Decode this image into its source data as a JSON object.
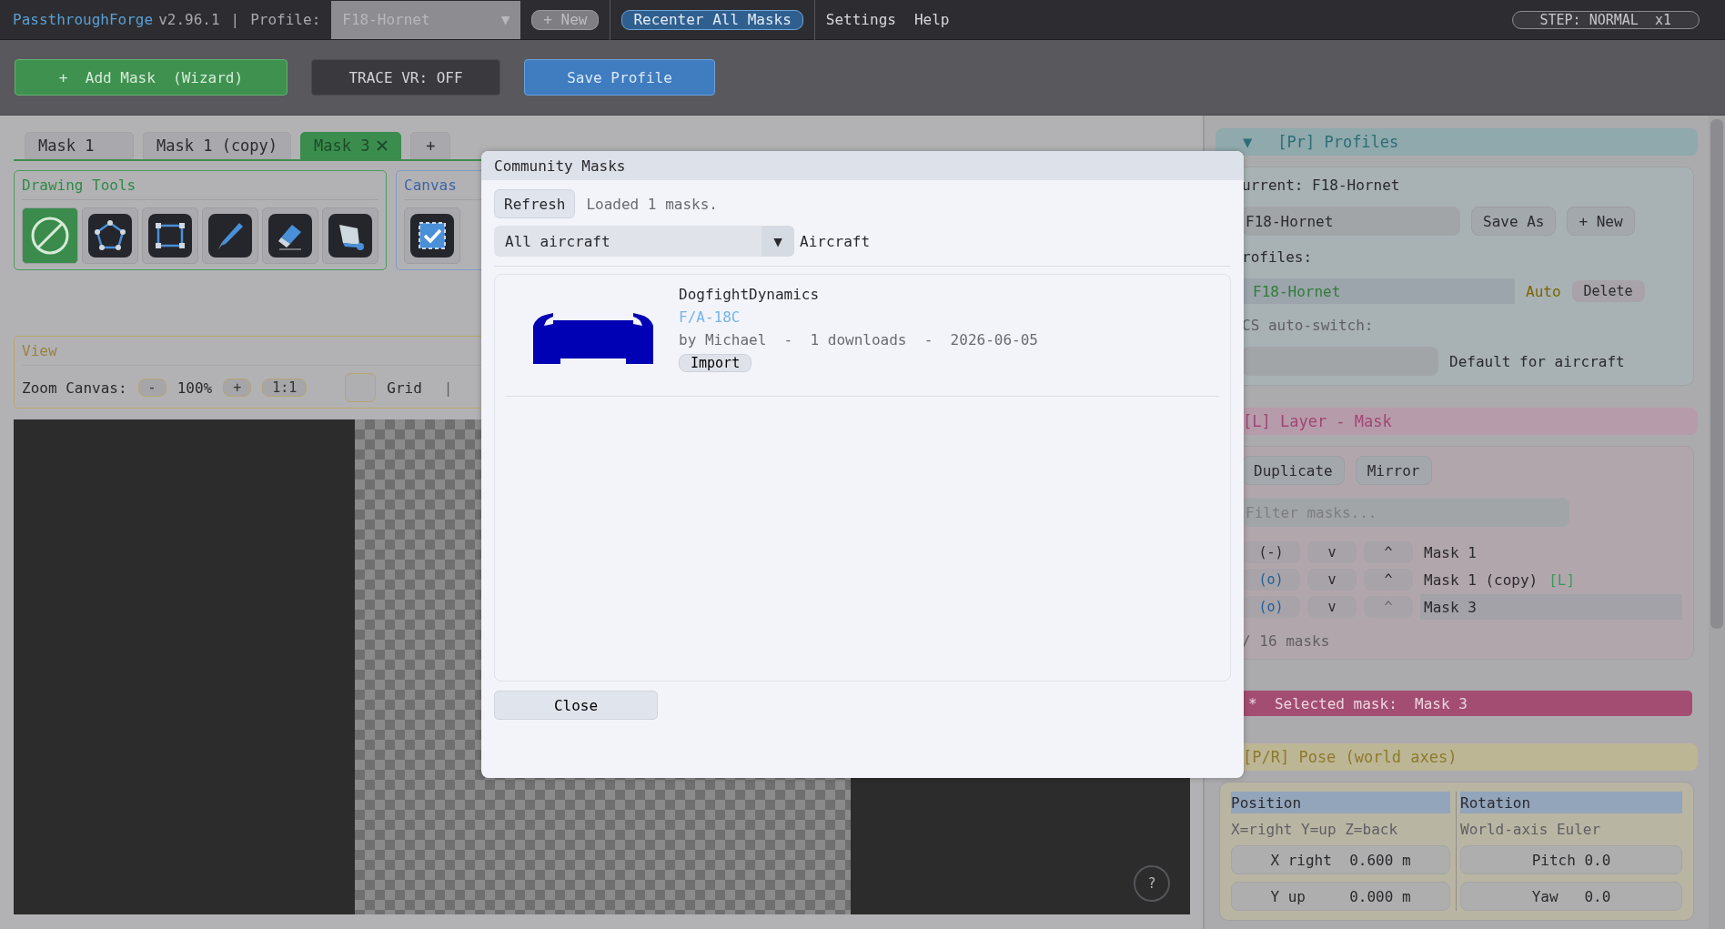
{
  "topbar": {
    "title": "PassthroughForge",
    "version": "v2.96.1",
    "separator": "|",
    "profile_label": "Profile:",
    "profile_value": "F18-Hornet",
    "profile_arrow": "▼",
    "new_button": "+ New",
    "recenter_button": "Recenter All Masks",
    "menu": [
      "Settings",
      "Help"
    ],
    "step_badge": "STEP: NORMAL  x1"
  },
  "toolbar": [
    {
      "label": "+  Add Mask  (Wizard)",
      "kind": "green"
    },
    {
      "label": "TRACE VR: OFF",
      "kind": "dark"
    },
    {
      "label": "Save Profile",
      "kind": "blue"
    }
  ],
  "tabs": [
    {
      "label": "Mask 1",
      "selected": false
    },
    {
      "label": "Mask 1 (copy)",
      "selected": false
    },
    {
      "label": "Mask 3",
      "selected": true
    }
  ],
  "add_tab": "+",
  "drawing_tools": {
    "title": "Drawing Tools",
    "tools": [
      {
        "kind": "none",
        "selected": true
      },
      {
        "kind": "polygon",
        "selected": false
      },
      {
        "kind": "rectangle",
        "selected": false
      },
      {
        "kind": "brush",
        "selected": false
      },
      {
        "kind": "eraser",
        "selected": false
      },
      {
        "kind": "fill",
        "selected": false
      }
    ]
  },
  "canvas_group": {
    "title": "Canvas",
    "tools": [
      {
        "kind": "select"
      }
    ]
  },
  "view": {
    "title": "View",
    "zoom_label": "Zoom Canvas:",
    "zoom_minus": "-",
    "zoom_value": "100%",
    "zoom_plus": "+",
    "zoom_reset": "1:1",
    "grid": {
      "label": "Grid",
      "checked": false
    },
    "separator": "|"
  },
  "help_button": "?",
  "dialog": {
    "title": "Community Masks",
    "refresh_button": "Refresh",
    "status": "Loaded 1 masks.",
    "filter": {
      "value": "All aircraft",
      "arrow": "▼",
      "label": "Aircraft"
    },
    "results": [
      {
        "author": "DogfightDynamics",
        "aircraft": "F/A-18C",
        "meta": "by Michael  -  1 downloads  -  2026-06-05",
        "import_button": "Import"
      }
    ],
    "close_button": "Close"
  },
  "profiles": {
    "arrow": "▼",
    "title": "[Pr] Profiles",
    "current": "urrent: F18-Hornet",
    "name_field": "F18-Hornet",
    "save_as": "Save As",
    "new_button": "+ New",
    "list_label": "rofiles:",
    "list": [
      {
        "name": "F18-Hornet",
        "selected": true,
        "auto": "Auto",
        "delete_button": "Delete"
      }
    ],
    "auto_switch_label": "CS auto-switch:",
    "default_label": "Default for aircraft"
  },
  "layer": {
    "title": "[L] Layer - Mask",
    "buttons": [
      "Duplicate",
      "Mirror"
    ],
    "filter_placeholder": "Filter masks...",
    "masks": [
      {
        "visibility": "(-)",
        "visible": false,
        "down": "v",
        "up": "^",
        "up_disabled": false,
        "name": "Mask 1",
        "selected": false
      },
      {
        "visibility": "(o)",
        "visible": true,
        "down": "v",
        "up": "^",
        "up_disabled": false,
        "name": "Mask 1 (copy)",
        "tag": "[L]",
        "selected": false
      },
      {
        "visibility": "(o)",
        "visible": true,
        "down": "v",
        "up": "^",
        "up_disabled": true,
        "name": "Mask 3",
        "selected": true
      }
    ],
    "count": "/ 16 masks"
  },
  "selected_bar": "*  Selected mask:  Mask 3",
  "pose": {
    "title": "[P/R] Pose (world axes)",
    "columns": [
      {
        "header": "Position",
        "hint": "X=right Y=up Z=back",
        "fields": [
          "X right  0.600 m",
          "Y up     0.000 m"
        ]
      },
      {
        "header": "Rotation",
        "hint": "World-axis Euler",
        "fields": [
          "Pitch 0.0",
          "Yaw   0.0"
        ]
      }
    ]
  }
}
